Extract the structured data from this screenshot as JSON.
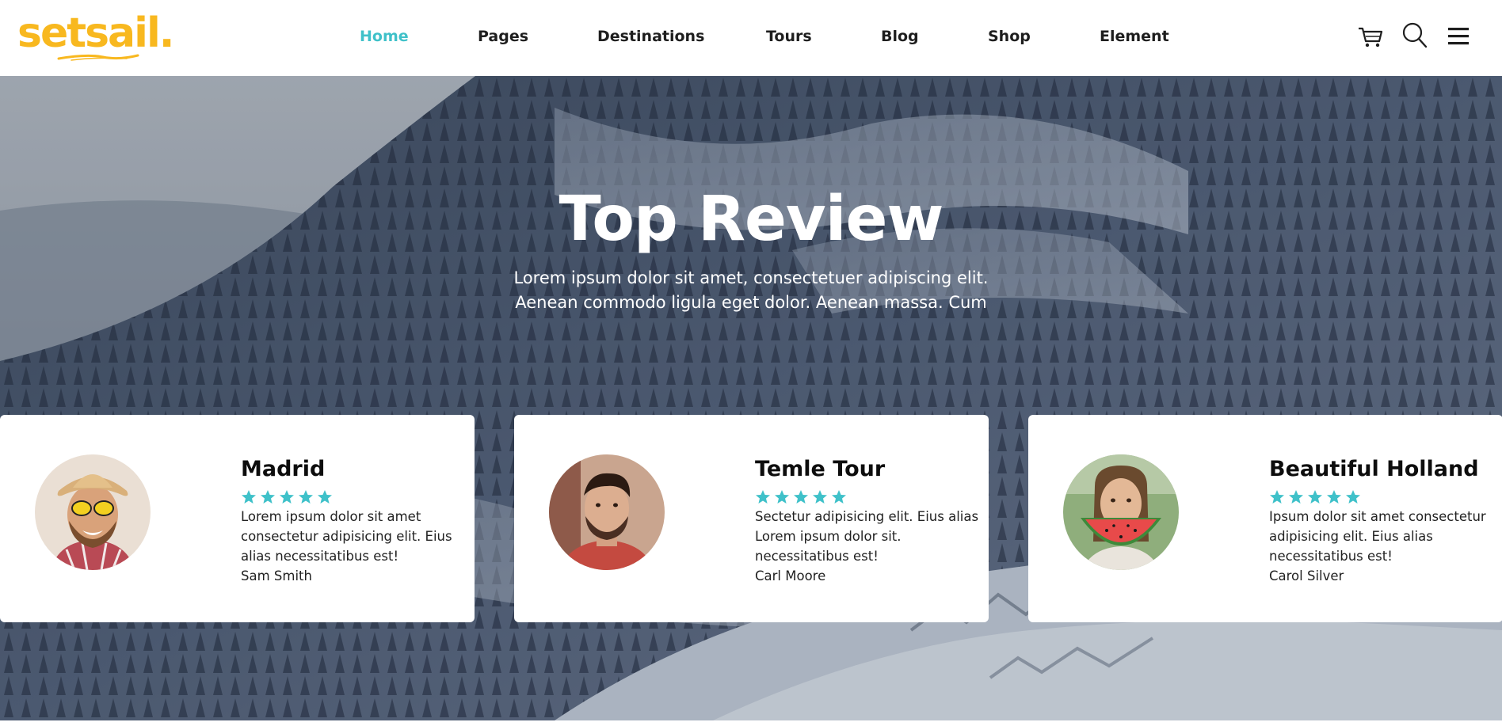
{
  "brand": {
    "name": "setsail.",
    "color": "#f8b81f"
  },
  "nav": {
    "items": [
      {
        "label": "Home",
        "active": true
      },
      {
        "label": "Pages",
        "active": false
      },
      {
        "label": "Destinations",
        "active": false
      },
      {
        "label": "Tours",
        "active": false
      },
      {
        "label": "Blog",
        "active": false
      },
      {
        "label": "Shop",
        "active": false
      },
      {
        "label": "Element",
        "active": false
      }
    ],
    "active_color": "#3fc1c9"
  },
  "header_icons": [
    "cart-icon",
    "search-icon",
    "menu-icon"
  ],
  "hero": {
    "title": "Top Review",
    "subtitle_line1": "Lorem ipsum dolor sit amet, consectetuer adipiscing elit.",
    "subtitle_line2": "Aenean commodo ligula eget dolor. Aenean massa. Cum"
  },
  "reviews": [
    {
      "title": "Madrid",
      "rating": 5,
      "text": "Lorem ipsum dolor sit amet consectetur adipisicing elit. Eius alias necessitatibus est!",
      "author": "Sam Smith"
    },
    {
      "title": "Temle Tour",
      "rating": 5,
      "text": "Sectetur adipisicing elit. Eius alias Lorem ipsum dolor sit. necessitatibus est!",
      "author": "Carl Moore"
    },
    {
      "title": "Beautiful Holland",
      "rating": 5,
      "text": "Ipsum dolor sit amet consectetur adipisicing elit. Eius alias necessitatibus est!",
      "author": "Carol Silver"
    }
  ],
  "colors": {
    "star": "#3fc1c9",
    "accent": "#3fc1c9"
  }
}
